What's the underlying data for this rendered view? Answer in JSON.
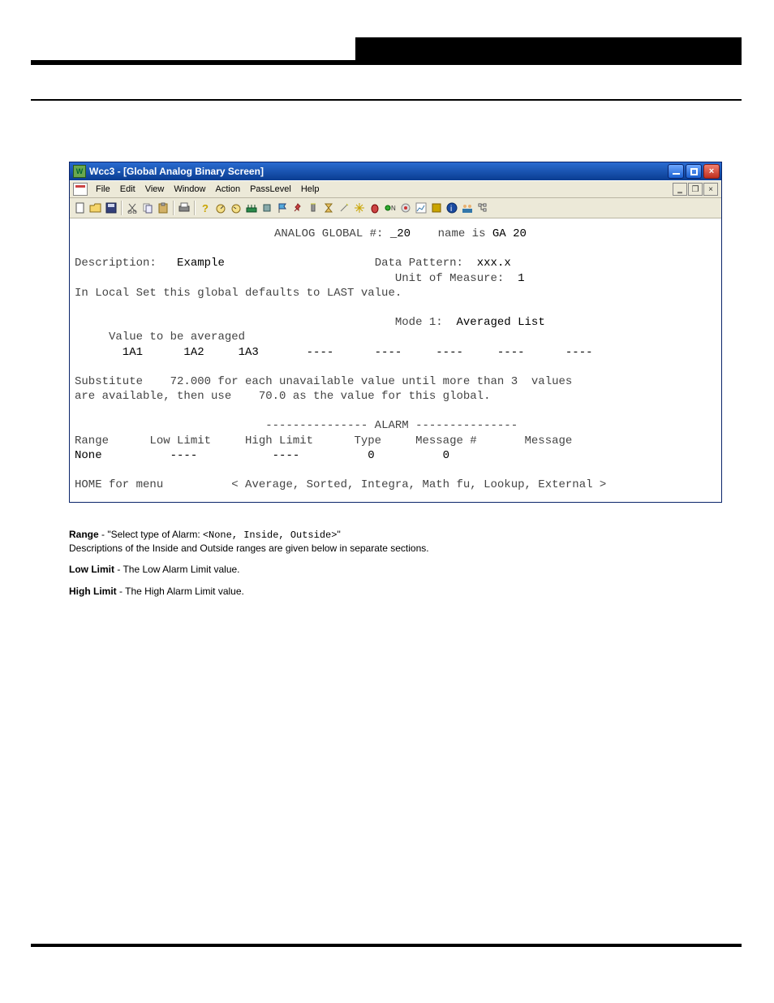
{
  "window": {
    "title": "Wcc3 - [Global Analog Binary Screen]",
    "menus": [
      "File",
      "Edit",
      "View",
      "Window",
      "Action",
      "PassLevel",
      "Help"
    ]
  },
  "toolbar_icons": [
    "new-icon",
    "open-icon",
    "save-icon",
    "cut-icon",
    "copy-icon",
    "paste-icon",
    "print-icon",
    "help-icon",
    "gauge-icon",
    "gauge2-icon",
    "router-icon",
    "chip-icon",
    "flag-icon",
    "pin-icon",
    "flashlight-icon",
    "hourglass-icon",
    "wand-icon",
    "sparkle-icon",
    "bug-icon",
    "switch-icon",
    "record-icon",
    "chart-icon",
    "stop-icon",
    "info-icon",
    "people-icon",
    "tree-icon"
  ],
  "screen": {
    "header_label": "ANALOG GLOBAL #:",
    "header_num_prefix": "_",
    "header_num": "20",
    "header_name_label": "name is",
    "header_name": "GA 20",
    "desc_label": "Description:",
    "desc_value": "Example",
    "data_pattern_label": "Data Pattern:",
    "data_pattern_value": "xxx.x",
    "unit_label": "Unit of Measure:",
    "unit_value": "1",
    "local_set_line": "In Local Set this global defaults to LAST value.",
    "mode_label": "Mode 1:",
    "mode_value": "Averaged List",
    "values_label": "Value to be averaged",
    "values_row": "       1A1      1A2     1A3       ----      ----     ----     ----      ----",
    "sub_line1": "Substitute    72.000 for each unavailable value until more than 3  values",
    "sub_line2": "are available, then use    70.0 as the value for this global.",
    "alarm_header": "--------------- ALARM ---------------",
    "alarm_cols": "Range      Low Limit     High Limit      Type     Message #       Message",
    "alarm_vals": "None          ----           ----          0          0",
    "footer_home": "HOME for menu",
    "footer_hint": "< Average, Sorted, Integra, Math fu, Lookup, External >"
  },
  "below": {
    "range_label": "Range",
    "range_desc": " - \"Select type of Alarm: <",
    "range_opts": "None, Inside, Outside>",
    "range_tail": "\"\nDescriptions of the Inside and Outside ranges are given below in separate sections.",
    "lowlimit_label": "Low Limit",
    "lowlimit_text": " - The Low Alarm Limit value.",
    "highlimit_label": "High Limit",
    "highlimit_text": " - The High Alarm Limit value."
  }
}
